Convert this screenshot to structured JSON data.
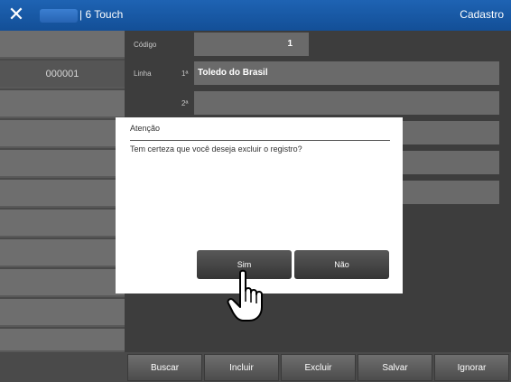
{
  "titlebar": {
    "close_icon": "close-icon",
    "left_title": "| 6 Touch",
    "right_title": "Cadastro"
  },
  "sidebar": {
    "rows": [
      "",
      "000001",
      "",
      "",
      "",
      "",
      "",
      "",
      "",
      "",
      "",
      ""
    ]
  },
  "form": {
    "codigo_label": "Código",
    "codigo_value": "1",
    "linha_label": "Linha",
    "linha_num1": "1ª",
    "linha_value1": "Toledo do Brasil",
    "linha_num2": "2ª"
  },
  "dialog": {
    "title": "Atenção",
    "message": "Tem certeza que você deseja excluir o registro?",
    "yes_label": "Sim",
    "no_label": "Não"
  },
  "footer": {
    "buttons": [
      "Buscar",
      "Incluir",
      "Excluir",
      "Salvar",
      "Ignorar"
    ]
  },
  "cursor": {
    "icon": "hand-pointer-icon"
  }
}
